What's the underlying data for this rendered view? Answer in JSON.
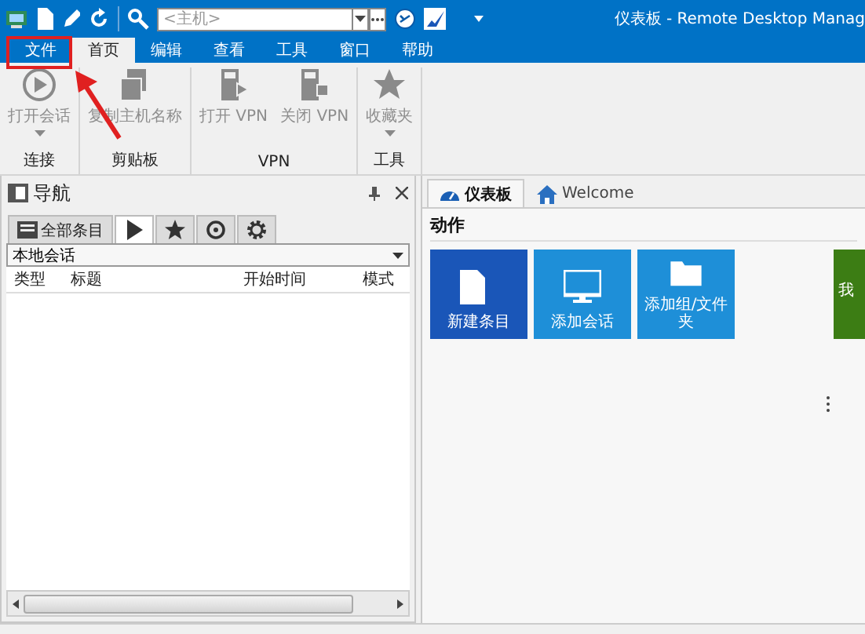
{
  "quick_access": {
    "host_field": {
      "placeholder": "<主机>"
    }
  },
  "window": {
    "title": "仪表板 - Remote Desktop Manag"
  },
  "menu_tabs": [
    {
      "label": "文件",
      "selected": false
    },
    {
      "label": "首页",
      "selected": true
    },
    {
      "label": "编辑",
      "selected": false
    },
    {
      "label": "查看",
      "selected": false
    },
    {
      "label": "工具",
      "selected": false
    },
    {
      "label": "窗口",
      "selected": false
    },
    {
      "label": "帮助",
      "selected": false
    }
  ],
  "ribbon_groups": [
    {
      "label": "连接",
      "buttons": [
        {
          "label": "打开会话",
          "kind": "play",
          "disabled": true,
          "dropdown": true
        }
      ]
    },
    {
      "label": "剪贴板",
      "buttons": [
        {
          "label": "复制主机名称",
          "kind": "copy",
          "disabled": true,
          "dropdown": false
        }
      ]
    },
    {
      "label": "VPN",
      "buttons": [
        {
          "label": "打开 VPN",
          "kind": "vpn-open",
          "disabled": true,
          "dropdown": false
        },
        {
          "label": "关闭 VPN",
          "kind": "vpn-close",
          "disabled": true,
          "dropdown": false
        }
      ]
    },
    {
      "label": "工具",
      "buttons": [
        {
          "label": "收藏夹",
          "kind": "star",
          "disabled": true,
          "dropdown": true
        }
      ]
    }
  ],
  "navigation": {
    "title": "导航",
    "tabs": [
      {
        "kind": "all",
        "label": "全部条目",
        "selected": false
      },
      {
        "kind": "play",
        "selected": true
      },
      {
        "kind": "star",
        "selected": false
      },
      {
        "kind": "history",
        "selected": false
      },
      {
        "kind": "gear",
        "selected": false
      }
    ],
    "filter": {
      "value": "本地会话"
    },
    "columns": [
      "类型",
      "标题",
      "开始时间",
      "模式"
    ]
  },
  "document_tabs": [
    {
      "label": "仪表板",
      "kind": "dashboard",
      "selected": true
    },
    {
      "label": "Welcome",
      "kind": "home",
      "selected": false
    }
  ],
  "dashboard": {
    "section": "动作",
    "tiles": [
      {
        "label": "新建条目",
        "kind": "file",
        "color": "#1a56b8"
      },
      {
        "label": "添加会话",
        "kind": "monitor",
        "color": "#1e8fd8"
      },
      {
        "label": "添加组/文件夹",
        "kind": "folder",
        "color": "#1e8fd8"
      },
      {
        "label": "我",
        "kind": "plain",
        "color": "#3c7d14"
      }
    ]
  }
}
